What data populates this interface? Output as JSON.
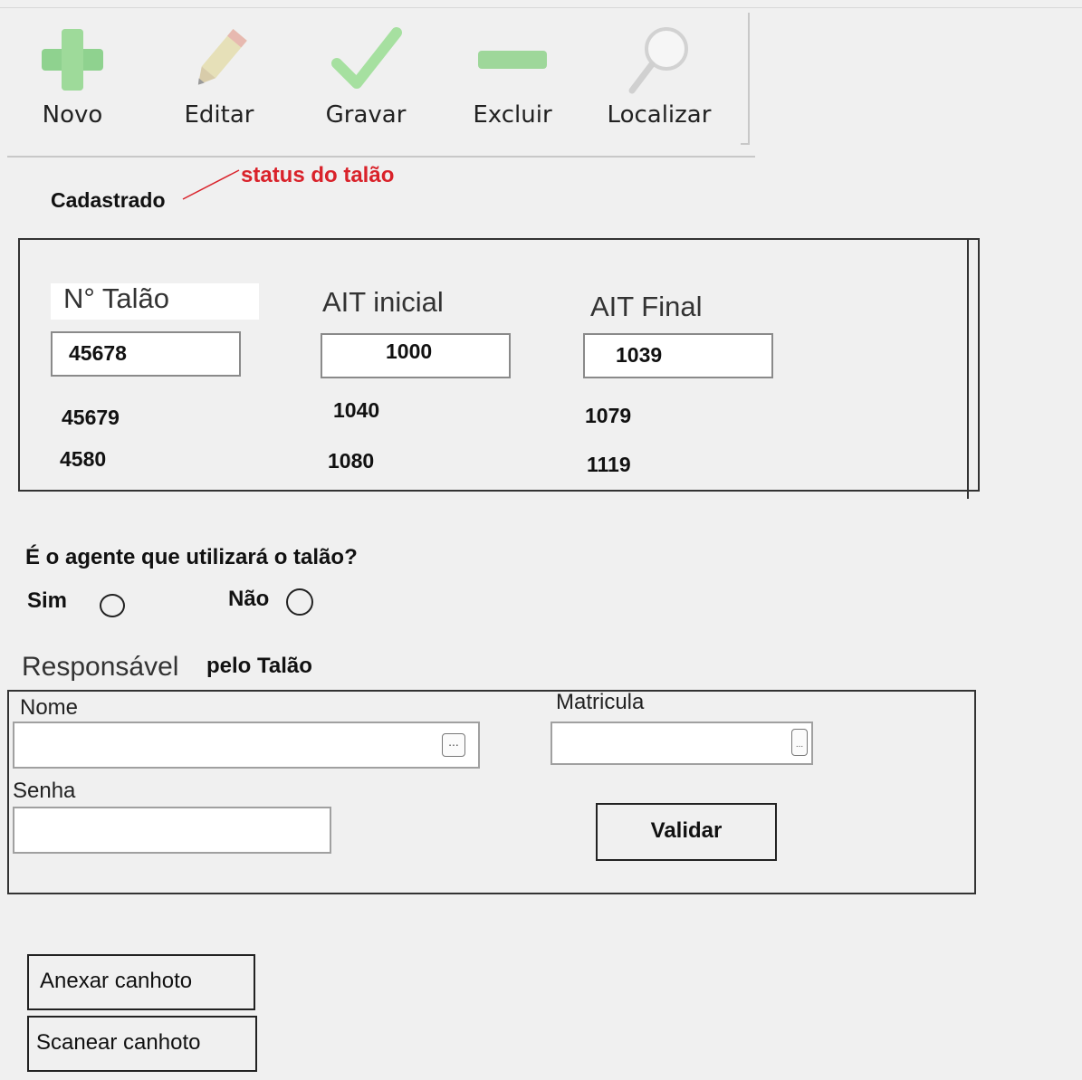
{
  "toolbar": {
    "buttons": [
      {
        "label": "Novo",
        "icon": "plus-icon"
      },
      {
        "label": "Editar",
        "icon": "pencil-icon"
      },
      {
        "label": "Gravar",
        "icon": "check-icon"
      },
      {
        "label": "Excluir",
        "icon": "minus-icon"
      },
      {
        "label": "Localizar",
        "icon": "magnifier-icon"
      }
    ]
  },
  "status": {
    "value": "Cadastrado",
    "note": "status do talão",
    "note_color": "#d9222a"
  },
  "talao": {
    "headers": {
      "numero": "N° Talão",
      "ait_inicial": "AIT inicial",
      "ait_final": "AIT Final"
    },
    "current": {
      "numero": "45678",
      "ait_inicial": "1000",
      "ait_final": "1039"
    },
    "rows": [
      {
        "numero": "45679",
        "ait_inicial": "1040",
        "ait_final": "1079"
      },
      {
        "numero": "4580",
        "ait_inicial": "1080",
        "ait_final": "1119"
      }
    ]
  },
  "agent_question": {
    "text": "É o agente que utilizará o talão?",
    "options": [
      {
        "label": "Sim"
      },
      {
        "label": "Não"
      }
    ]
  },
  "responsavel": {
    "title_part1": "Responsável",
    "title_part2": "pelo Talão",
    "nome_label": "Nome",
    "nome_value": "",
    "matricula_label": "Matricula",
    "matricula_value": "",
    "senha_label": "Senha",
    "senha_value": "",
    "validar_label": "Validar"
  },
  "canhoto": {
    "anexar_label": "Anexar canhoto",
    "scanear_label": "Scanear canhoto"
  }
}
